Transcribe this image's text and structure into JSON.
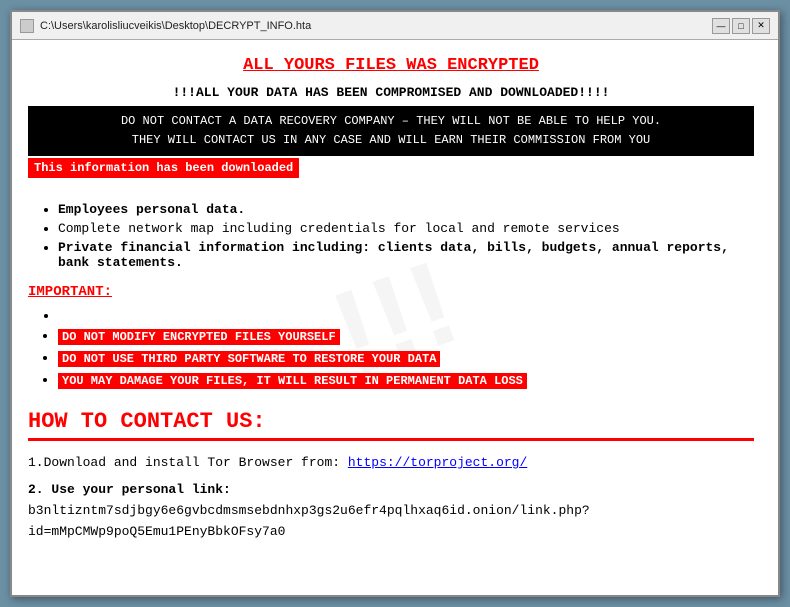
{
  "window": {
    "title": "C:\\Users\\karolisliucveikis\\Desktop\\DECRYPT_INFO.hta",
    "icon_label": "file-icon"
  },
  "titlebar": {
    "minimize_label": "—",
    "maximize_label": "□",
    "close_label": "✕"
  },
  "content": {
    "main_title": "ALL YOURS FILES WAS ENCRYPTED",
    "exclaim_line": "!!!ALL YOUR DATA HAS BEEN COMPROMISED AND DOWNLOADED!!!!",
    "black_block_line1": "DO NOT CONTACT A DATA RECOVERY COMPANY – THEY WILL NOT BE ABLE TO HELP YOU.",
    "black_block_line2": "THEY WILL CONTACT US IN ANY CASE AND WILL EARN THEIR COMMISSION FROM YOU",
    "red_banner": "This information has been downloaded",
    "bullet_items": [
      "Employees personal data.",
      "Complete network map including credentials for local and remote services",
      "Private financial information including: clients data, bills, budgets, annual reports, bank statements."
    ],
    "important_label": "IMPORTANT:",
    "warning_items": [
      "DO NOT MODIFY ENCRYPTED FILES YOURSELF",
      "DO NOT USE THIRD PARTY SOFTWARE TO RESTORE YOUR DATA",
      "YOU MAY DAMAGE YOUR FILES, IT WILL RESULT IN PERMANENT DATA LOSS"
    ],
    "how_to_title": "HOW TO CONTACT US:",
    "step1_prefix": "1.Download and install Tor Browser from: ",
    "step1_link": "https://torproject.org/",
    "step2_label": "2. Use your personal link:",
    "step2_link": "b3nltizntm7sdjbgy6e6gvbcdmsmsebdnhxp3gs2u6efr4pqlhxaq6id.onion/link.php?id=mMpCMWp9poQ5Emu1PEnyBbkOFsy7a0",
    "watermark": "!!!"
  }
}
